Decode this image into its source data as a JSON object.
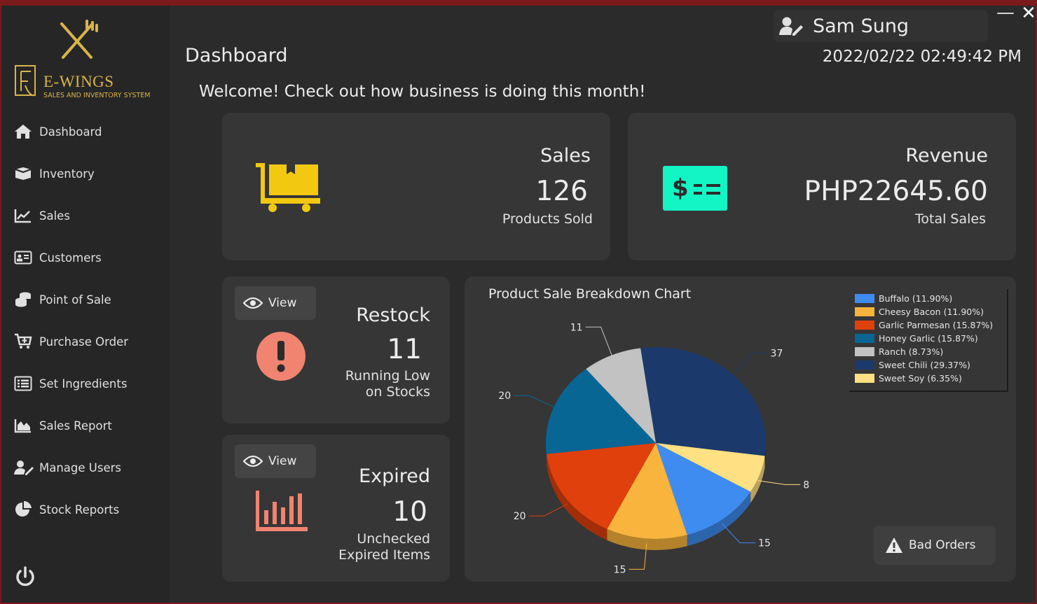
{
  "brand": {
    "name": "E-WINGS",
    "subtitle": "SALES AND INVENTORY SYSTEM"
  },
  "sidebar": {
    "items": [
      {
        "label": "Dashboard",
        "icon": "home-icon"
      },
      {
        "label": "Inventory",
        "icon": "box-icon"
      },
      {
        "label": "Sales",
        "icon": "line-chart-icon"
      },
      {
        "label": "Customers",
        "icon": "id-card-icon"
      },
      {
        "label": "Point of Sale",
        "icon": "coins-icon"
      },
      {
        "label": "Purchase Order",
        "icon": "cart-plus-icon"
      },
      {
        "label": "Set Ingredients",
        "icon": "list-icon"
      },
      {
        "label": "Sales Report",
        "icon": "area-chart-icon"
      },
      {
        "label": "Manage Users",
        "icon": "user-edit-icon"
      },
      {
        "label": "Stock Reports",
        "icon": "pie-icon"
      }
    ]
  },
  "header": {
    "title": "Dashboard",
    "user": "Sam Sung",
    "datetime": "2022/02/22 02:49:42 PM",
    "welcome": "Welcome! Check out how business is doing this month!",
    "minimize": "—",
    "close": "✕"
  },
  "sales_card": {
    "title": "Sales",
    "value": "126",
    "caption": "Products Sold",
    "icon_color": "#f2c811"
  },
  "revenue_card": {
    "title": "Revenue",
    "value": "PHP22645.60",
    "caption": "Total Sales",
    "icon_color": "#13f5c4"
  },
  "restock_card": {
    "view_label": "View",
    "title": "Restock",
    "value": "11",
    "caption_line1": "Running Low",
    "caption_line2": "on Stocks",
    "icon_color": "#f08470"
  },
  "expired_card": {
    "view_label": "View",
    "title": "Expired",
    "value": "10",
    "caption_line1": "Unchecked",
    "caption_line2": "Expired Items",
    "icon_color": "#f08470"
  },
  "bad_orders_label": "Bad Orders",
  "chart_data": {
    "type": "pie",
    "title": "Product Sale Breakdown Chart",
    "slices": [
      {
        "label": "Sweet Chili",
        "value": 37,
        "percent": "29.37%",
        "color": "#1b3a6b"
      },
      {
        "label": "Sweet Soy",
        "value": 8,
        "percent": "6.35%",
        "color": "#ffe082"
      },
      {
        "label": "Buffalo",
        "value": 15,
        "percent": "11.90%",
        "color": "#3f8cf0"
      },
      {
        "label": "Cheesy Bacon",
        "value": 15,
        "percent": "11.90%",
        "color": "#f8b43c"
      },
      {
        "label": "Garlic Parmesan",
        "value": 20,
        "percent": "15.87%",
        "color": "#e0400c"
      },
      {
        "label": "Honey Garlic",
        "value": 20,
        "percent": "15.87%",
        "color": "#086694"
      },
      {
        "label": "Ranch",
        "value": 11,
        "percent": "8.73%",
        "color": "#c2c2c2"
      }
    ],
    "legend": [
      {
        "text": "Buffalo (11.90%)",
        "color": "#3f8cf0"
      },
      {
        "text": "Cheesy Bacon (11.90%)",
        "color": "#f8b43c"
      },
      {
        "text": "Garlic Parmesan (15.87%)",
        "color": "#e0400c"
      },
      {
        "text": "Honey Garlic (15.87%)",
        "color": "#086694"
      },
      {
        "text": "Ranch (8.73%)",
        "color": "#c2c2c2"
      },
      {
        "text": "Sweet Chili (29.37%)",
        "color": "#1b3a6b"
      },
      {
        "text": "Sweet Soy (6.35%)",
        "color": "#ffe082"
      }
    ],
    "legend_placement": "top-right"
  }
}
